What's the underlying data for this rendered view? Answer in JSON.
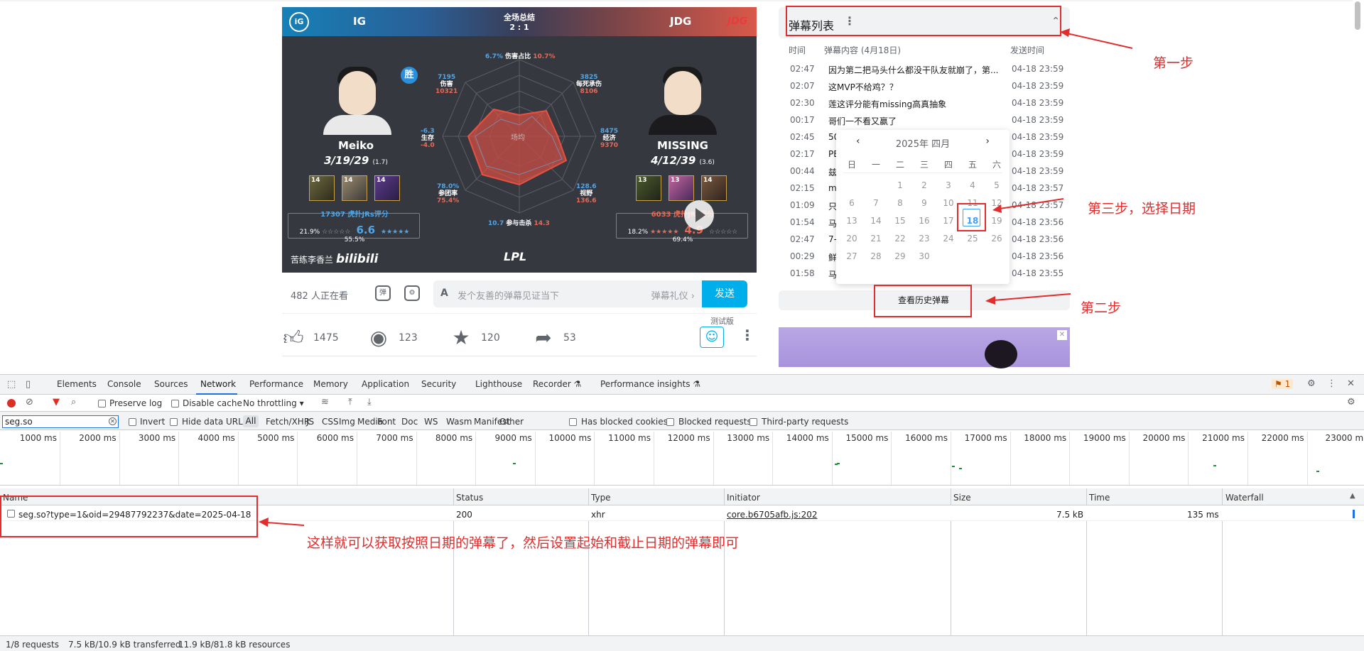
{
  "video": {
    "team_left": "IG",
    "team_right": "JDG",
    "logo_left": "iG",
    "logo_right": "JDG",
    "summary_title": "全场总结",
    "score": "2 : 1",
    "win_badge": "胜",
    "left_player": {
      "name": "Meiko",
      "kda": "3/19/29",
      "kda_ratio": "(1.7)",
      "heroes": [
        "14",
        "14",
        "14"
      ],
      "rating_title": "17307 虎扑JRs评分",
      "rating_left": "21.9%",
      "rating_score": "6.6",
      "rating_right": "55.5%"
    },
    "right_player": {
      "name": "MISSING",
      "kda": "4/12/39",
      "kda_ratio": "(3.6)",
      "heroes": [
        "13",
        "13",
        "14"
      ],
      "rating_title": "6033 虎扑JRs评分",
      "rating_left": "18.2%",
      "rating_score": "4.9",
      "rating_right": "69.4%"
    },
    "stats": {
      "damage_share": {
        "label": "伤害占比",
        "blue": "6.7%",
        "red": "10.7%"
      },
      "damage": {
        "label": "伤害",
        "blue": "7195",
        "red": "10321"
      },
      "per_death": {
        "label": "每死承伤",
        "blue": "3825",
        "red": "8106"
      },
      "economy": {
        "label": "经济",
        "blue": "8475",
        "red": "9370"
      },
      "survival": {
        "label": "生存",
        "blue": "-6.3",
        "red": "-4.0"
      },
      "teamfight": {
        "label": "参团率",
        "blue": "78.0%",
        "red": "75.4%"
      },
      "vision": {
        "label": "视野",
        "blue": "128.6",
        "red": "136.6"
      },
      "participation": {
        "label": "参与击杀",
        "blue": "10.7",
        "red": "14.3"
      },
      "center": "场均"
    },
    "watermark": "苦练李香兰",
    "watermark_brand": "bilibili",
    "league_logo": "LPL"
  },
  "controls": {
    "watching": "482 人正在看",
    "danmaku_toggle_icon": "弹",
    "danmaku_settings_icon": "⚙",
    "input_icon": "A",
    "input_placeholder": "发个友善的弹幕见证当下",
    "etiquette": "弹幕礼仪 ›",
    "send": "发送"
  },
  "actions": {
    "like": "1475",
    "coin": "123",
    "favorite": "120",
    "share": "53",
    "beta_tag": "测试版"
  },
  "danmaku_panel": {
    "title": "弹幕列表",
    "col_time": "时间",
    "col_content": "弹幕内容 (4月18日)",
    "col_sent": "发送时间",
    "rows": [
      {
        "t": "02:47",
        "c": "因为第二把马头什么都没干队友就崩了，第...",
        "s": "04-18 23:59"
      },
      {
        "t": "02:07",
        "c": "这MVP不给鸡？？",
        "s": "04-18 23:59"
      },
      {
        "t": "02:30",
        "c": "莲这评分能有missing高真抽象",
        "s": "04-18 23:59"
      },
      {
        "t": "00:17",
        "c": "哥们一不看又赢了",
        "s": "04-18 23:59"
      },
      {
        "t": "02:45",
        "c": "50",
        "s": "04-18 23:59"
      },
      {
        "t": "02:17",
        "c": "PE",
        "s": "04-18 23:59"
      },
      {
        "t": "00:44",
        "c": "兹",
        "s": "04-18 23:59"
      },
      {
        "t": "02:15",
        "c": "mi",
        "s": "04-18 23:57"
      },
      {
        "t": "01:09",
        "c": "只",
        "s": "04-18 23:57"
      },
      {
        "t": "01:54",
        "c": "马",
        "s": "04-18 23:56"
      },
      {
        "t": "02:47",
        "c": "7-",
        "s": "04-18 23:56"
      },
      {
        "t": "00:29",
        "c": "鲜",
        "s": "04-18 23:56"
      },
      {
        "t": "01:58",
        "c": "马",
        "s": "04-18 23:55"
      }
    ],
    "history_button": "查看历史弹幕"
  },
  "calendar": {
    "header": "2025年 四月",
    "prev": "‹",
    "next": "›",
    "weekdays": [
      "日",
      "一",
      "二",
      "三",
      "四",
      "五",
      "六"
    ],
    "weeks": [
      [
        "",
        "",
        "1",
        "2",
        "3",
        "4",
        "5"
      ],
      [
        "6",
        "7",
        "8",
        "9",
        "10",
        "11",
        "12"
      ],
      [
        "13",
        "14",
        "15",
        "16",
        "17",
        "18",
        "19"
      ],
      [
        "20",
        "21",
        "22",
        "23",
        "24",
        "25",
        "26"
      ],
      [
        "27",
        "28",
        "29",
        "30",
        "",
        "",
        ""
      ]
    ],
    "selected": "18"
  },
  "annotations": {
    "step1": "第一步",
    "step2": "第二步",
    "step3": "第三步，选择日期",
    "result": "这样就可以获取按照日期的弹幕了，然后设置起始和截止日期的弹幕即可"
  },
  "devtools": {
    "tabs": [
      "Elements",
      "Console",
      "Sources",
      "Network",
      "Performance",
      "Memory",
      "Application",
      "Security",
      "Lighthouse",
      "Recorder ⚗",
      "Performance insights ⚗"
    ],
    "active_tab": "Network",
    "issues_badge": "1",
    "toolbar": {
      "preserve_log": "Preserve log",
      "disable_cache": "Disable cache",
      "throttling": "No throttling ▾"
    },
    "filter": {
      "value": "seg.so",
      "invert": "Invert",
      "hide_data_urls": "Hide data URLs",
      "types": [
        "All",
        "Fetch/XHR",
        "JS",
        "CSS",
        "Img",
        "Media",
        "Font",
        "Doc",
        "WS",
        "Wasm",
        "Manifest",
        "Other"
      ],
      "has_blocked_cookies": "Has blocked cookies",
      "blocked_requests": "Blocked requests",
      "third_party": "Third-party requests"
    },
    "timeline_labels": [
      "1000 ms",
      "2000 ms",
      "3000 ms",
      "4000 ms",
      "5000 ms",
      "6000 ms",
      "7000 ms",
      "8000 ms",
      "9000 ms",
      "10000 ms",
      "11000 ms",
      "12000 ms",
      "13000 ms",
      "14000 ms",
      "15000 ms",
      "16000 ms",
      "17000 ms",
      "18000 ms",
      "19000 ms",
      "20000 ms",
      "21000 ms",
      "22000 ms",
      "23000 m"
    ],
    "columns": [
      "Name",
      "Status",
      "Type",
      "Initiator",
      "Size",
      "Time",
      "Waterfall"
    ],
    "request": {
      "name": "seg.so?type=1&oid=29487792237&date=2025-04-18",
      "status": "200",
      "type": "xhr",
      "initiator": "core.b6705afb.js:202",
      "size": "7.5 kB",
      "time": "135 ms"
    },
    "statusbar": {
      "requests": "1/8 requests",
      "transferred": "7.5 kB/10.9 kB transferred",
      "resources": "11.9 kB/81.8 kB resources"
    }
  }
}
